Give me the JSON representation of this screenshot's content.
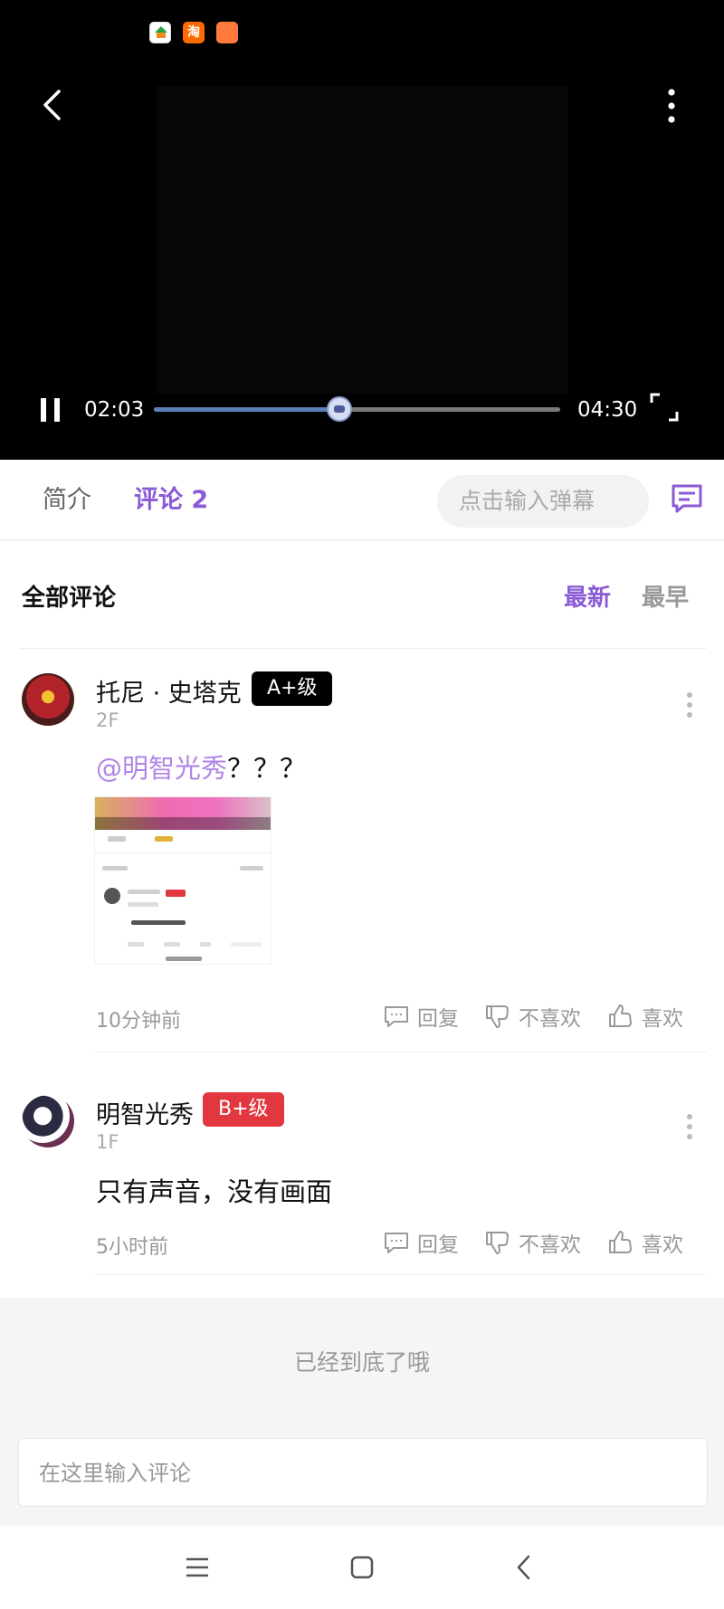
{
  "player": {
    "current_time": "02:03",
    "total_time": "04:30",
    "progress_fraction": 0.4556
  },
  "tabs": {
    "intro": "简介",
    "comments": "评论 2"
  },
  "danmaku": {
    "placeholder": "点击输入弹幕"
  },
  "comments_header": {
    "title": "全部评论",
    "sort_newest": "最新",
    "sort_oldest": "最早"
  },
  "actions": {
    "reply": "回复",
    "dislike": "不喜欢",
    "like": "喜欢"
  },
  "comments": [
    {
      "username": "托尼 · 史塔克",
      "badge": "A+级",
      "floor": "2F",
      "mention": "@明智光秀",
      "text": "？？？",
      "time": "10分钟前"
    },
    {
      "username": "明智光秀",
      "badge": "B+级",
      "floor": "1F",
      "text": "只有声音，没有画面",
      "time": "5小时前"
    }
  ],
  "end_text": "已经到底了哦",
  "comment_input": {
    "placeholder": "在这里输入评论"
  },
  "colors": {
    "accent": "#8a5bd6",
    "mention": "#b185e6",
    "badge_a": "#000000",
    "badge_b": "#e0383e"
  }
}
